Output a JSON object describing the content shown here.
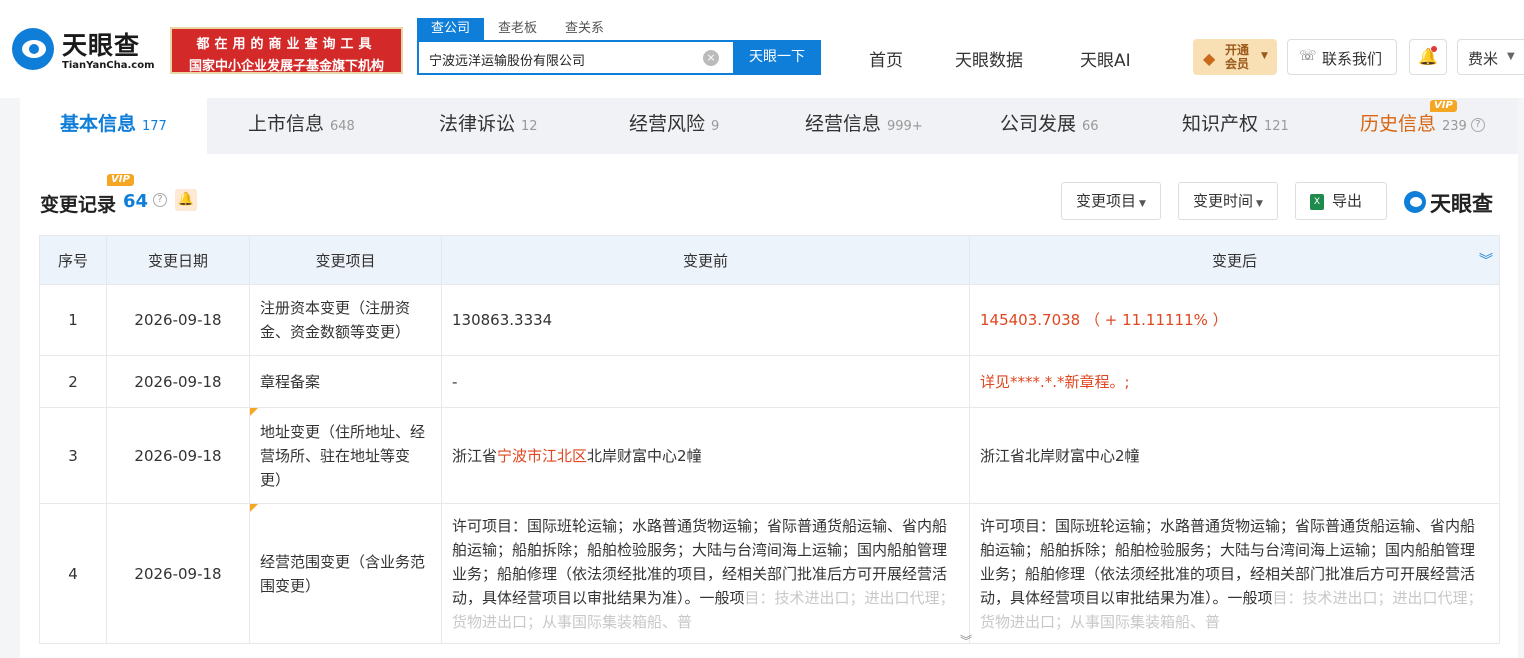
{
  "header": {
    "logo_cn": "天眼查",
    "logo_en": "TianYanCha.com",
    "slogan_line1": "都在用的商业查询工具",
    "slogan_line2": "国家中小企业发展子基金旗下机构",
    "search_tabs": [
      "查公司",
      "查老板",
      "查关系"
    ],
    "search_value": "宁波远洋运输股份有限公司",
    "search_button": "天眼一下",
    "nav": [
      "首页",
      "天眼数据",
      "天眼AI"
    ],
    "vip_label": "开通会员",
    "contact_label": "联系我们",
    "user_name": "费米"
  },
  "tabs": [
    {
      "label": "基本信息",
      "count": "177"
    },
    {
      "label": "上市信息",
      "count": "648"
    },
    {
      "label": "法律诉讼",
      "count": "12"
    },
    {
      "label": "经营风险",
      "count": "9"
    },
    {
      "label": "经营信息",
      "count": "999+"
    },
    {
      "label": "公司发展",
      "count": "66"
    },
    {
      "label": "知识产权",
      "count": "121"
    },
    {
      "label": "历史信息",
      "count": "239",
      "vip": "VIP"
    }
  ],
  "section": {
    "title": "变更记录",
    "count": "64",
    "vip": "VIP",
    "filter_item": "变更项目",
    "filter_time": "变更时间",
    "export": "导出",
    "brand": "天眼查"
  },
  "table": {
    "headers": [
      "序号",
      "变更日期",
      "变更项目",
      "变更前",
      "变更后"
    ],
    "rows": [
      {
        "no": "1",
        "date": "2026-09-18",
        "item": "注册资本变更（注册资金、资金数额等变更）",
        "before": "130863.3334",
        "after": "145403.7038 （ + 11.11111% ）"
      },
      {
        "no": "2",
        "date": "2026-09-18",
        "item": "章程备案",
        "before": "-",
        "after": "详见****.*.*新章程。;"
      },
      {
        "no": "3",
        "date": "2026-09-18",
        "item": "地址变更（住所地址、经营场所、驻在地址等变更）",
        "before_prefix": "浙江省",
        "before_highlight": "宁波市江北区",
        "before_suffix": "北岸财富中心2幢",
        "after": "浙江省北岸财富中心2幢"
      },
      {
        "no": "4",
        "date": "2026-09-18",
        "item": "经营范围变更（含业务范围变更）",
        "before": "许可项目：国际班轮运输；水路普通货物运输；省际普通货船运输、省内船舶运输；船舶拆除；船舶检验服务；大陆与台湾间海上运输；国内船舶管理业务；船舶修理（依法须经批准的项目，经相关部门批准后方可开展经营活动，具体经营项目以审批结果为准）。一般项",
        "before_faded": "目：技术进出口；进出口代理；货物进出口；从事国际集装箱船、普",
        "after": "许可项目：国际班轮运输；水路普通货物运输；省际普通货船运输、省内船舶运输；船舶拆除；船舶检验服务；大陆与台湾间海上运输；国内船舶管理业务；船舶修理（依法须经批准的项目，经相关部门批准后方可开展经营活动，具体经营项目以审批结果为准）。一般项",
        "after_faded": "目：技术进出口；进出口代理；货物进出口；从事国际集装箱船、普"
      }
    ]
  }
}
